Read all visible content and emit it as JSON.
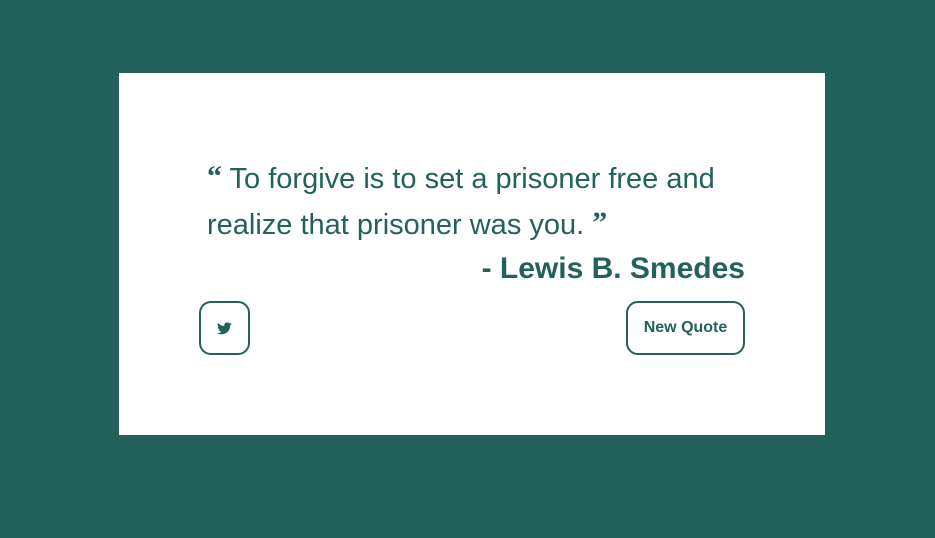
{
  "quote": {
    "open_mark": "“",
    "text": "To forgive is to set a prisoner free and realize that prisoner was you.",
    "close_mark": "”",
    "author": "- Lewis B. Smedes"
  },
  "actions": {
    "tweet_icon": "twitter-icon",
    "new_quote_label": "New Quote"
  },
  "colors": {
    "background": "#22625b",
    "card": "#ffffff",
    "accent": "#22625b"
  }
}
